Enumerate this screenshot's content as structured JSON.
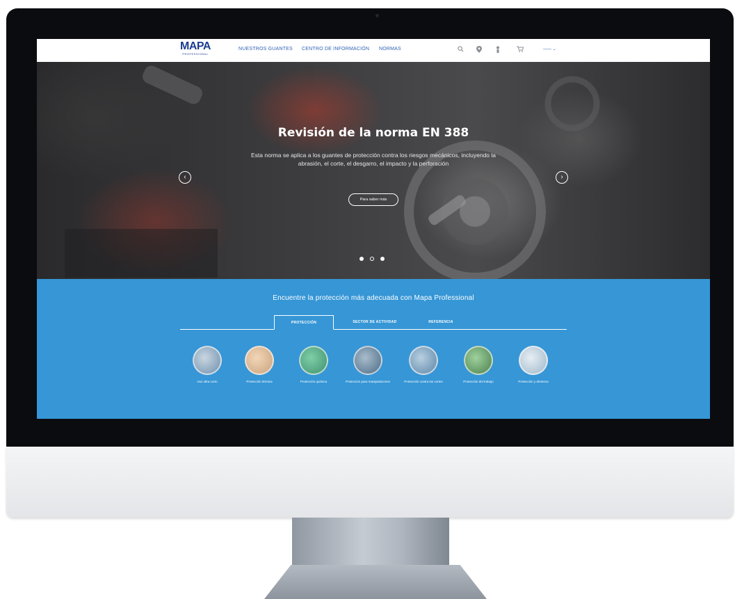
{
  "navbar": {
    "logo": "MAPA",
    "logo_sub": "PROFESSIONAL",
    "links": [
      "NUESTROS GUANTES",
      "CENTRO DE INFORMACIÓN",
      "NORMAS"
    ],
    "language": "—— ⌄"
  },
  "hero": {
    "title": "Revisión de la norma EN 388",
    "text": "Esta norma se aplica a los guantes de protección contra los riesgos mecánicos, incluyendo la abrasión, el corte, el desgarro, el impacto y la perforación",
    "button_label": "Para saber más",
    "prev_arrow": "‹",
    "next_arrow": "›",
    "slide_count": 3
  },
  "finder": {
    "title": "Encuentre la protección más adecuada con Mapa Professional",
    "tabs": [
      "PROTECCIÓN",
      "SECTOR DE ACTIVIDAD",
      "REFERENCIA"
    ],
    "active_tab": 0,
    "categories": [
      {
        "label": "Uso ultra corto",
        "color": "#6f8fae"
      },
      {
        "label": "Protección térmica",
        "color": "#c9a27c"
      },
      {
        "label": "Protección química",
        "color": "#3f8f6e"
      },
      {
        "label": "Protección para manipulaciones",
        "color": "#4b6b86"
      },
      {
        "label": "Protección contra los cortes",
        "color": "#5c86a8"
      },
      {
        "label": "Protección del trabajo",
        "color": "#4a7f4a"
      },
      {
        "label": "Protección y destreza",
        "color": "#9fb7c9"
      }
    ]
  },
  "colors": {
    "brand_blue": "#1b3d8f",
    "section_blue": "#3696d6",
    "nav_link": "#2f63b5"
  }
}
